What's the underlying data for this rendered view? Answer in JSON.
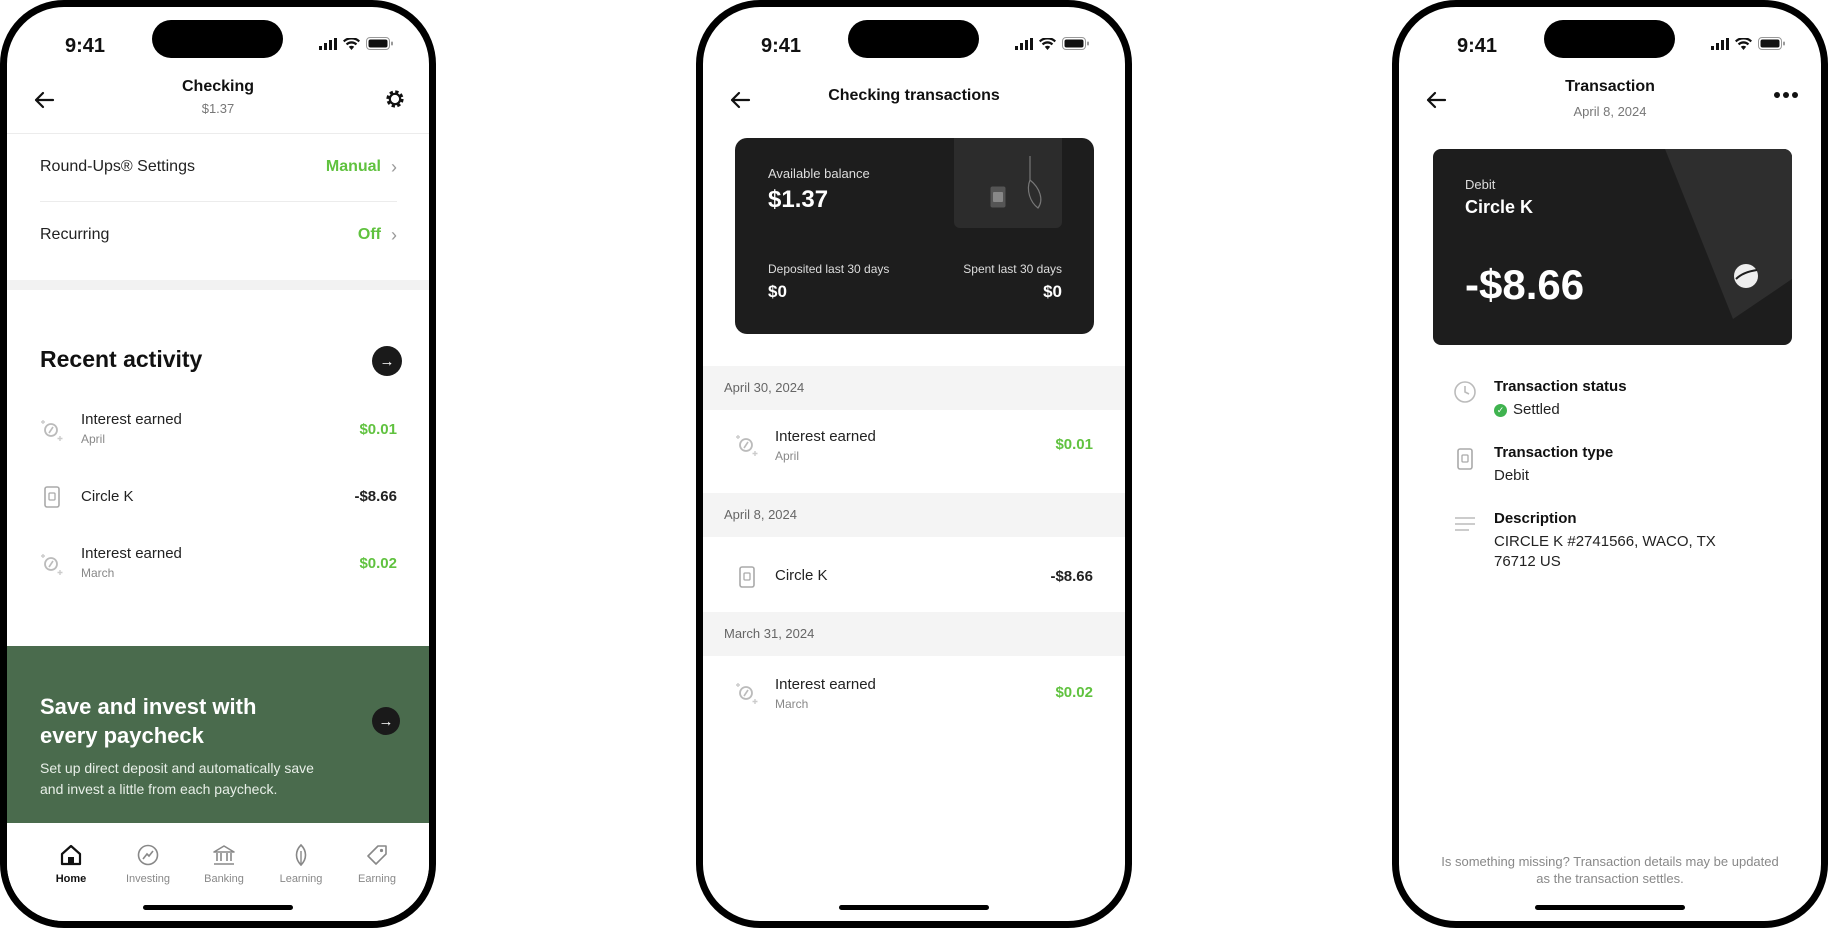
{
  "status": {
    "time": "9:41"
  },
  "phone1": {
    "header": {
      "title": "Checking",
      "subtitle": "$1.37"
    },
    "settings": [
      {
        "label": "Round-Ups® Settings",
        "value": "Manual"
      },
      {
        "label": "Recurring",
        "value": "Off"
      }
    ],
    "recent": {
      "title": "Recent activity",
      "items": [
        {
          "name": "Interest earned",
          "sub": "April",
          "amount": "$0.01",
          "icon": "interest-icon"
        },
        {
          "name": "Circle K",
          "sub": "",
          "amount": "-$8.66",
          "icon": "card-icon"
        },
        {
          "name": "Interest earned",
          "sub": "March",
          "amount": "$0.02",
          "icon": "interest-icon"
        }
      ]
    },
    "promo": {
      "title": "Save and invest with every paycheck",
      "text": "Set up direct deposit and automatically save and invest a little from each paycheck."
    },
    "tabs": [
      {
        "label": "Home",
        "icon": "home-icon"
      },
      {
        "label": "Investing",
        "icon": "investing-icon"
      },
      {
        "label": "Banking",
        "icon": "bank-icon"
      },
      {
        "label": "Learning",
        "icon": "leaf-icon"
      },
      {
        "label": "Earning",
        "icon": "tag-icon"
      }
    ]
  },
  "phone2": {
    "header": {
      "title": "Checking transactions"
    },
    "card": {
      "available_label": "Available balance",
      "available_value": "$1.37",
      "deposited_label": "Deposited last 30 days",
      "deposited_value": "$0",
      "spent_label": "Spent last 30 days",
      "spent_value": "$0"
    },
    "groups": [
      {
        "date": "April 30, 2024",
        "name": "Interest earned",
        "sub": "April",
        "amount": "$0.01"
      },
      {
        "date": "April 8, 2024",
        "name": "Circle K",
        "sub": "",
        "amount": "-$8.66"
      },
      {
        "date": "March 31, 2024",
        "name": "Interest earned",
        "sub": "March",
        "amount": "$0.02"
      }
    ]
  },
  "phone3": {
    "header": {
      "title": "Transaction",
      "subtitle": "April 8, 2024"
    },
    "card": {
      "type": "Debit",
      "merchant": "Circle K",
      "amount": "-$8.66"
    },
    "details": {
      "status_title": "Transaction status",
      "status_value": "Settled",
      "type_title": "Transaction type",
      "type_value": "Debit",
      "desc_title": "Description",
      "desc_value": "CIRCLE K #2741566, WACO, TX 76712 US"
    },
    "footnote": "Is something missing? Transaction details may be updated as the transaction settles."
  },
  "colors": {
    "positive": "#60c23f",
    "promo_bg": "#4a6b4d",
    "card_bg": "#1d1d1d",
    "settled": "#3fb34f"
  }
}
